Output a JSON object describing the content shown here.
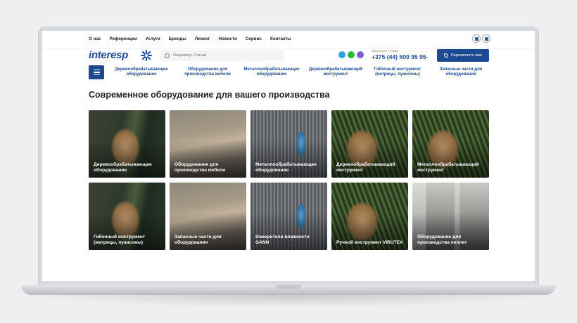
{
  "top_nav": [
    "О нас",
    "Референции",
    "Услуги",
    "Бренды",
    "Лизинг",
    "Новости",
    "Сервис",
    "Контакты"
  ],
  "logo": {
    "text": "interesp"
  },
  "search": {
    "placeholder": "Например: Станки"
  },
  "contact": {
    "caption": "Связаться с нами",
    "phone": "+375 (44) 500 95 95",
    "call_button": "Перезвоните мне"
  },
  "categories": [
    "Деревообрабатывающее оборудование",
    "Оборудование для производства мебели",
    "Металлообрабатывающее оборудование",
    "Деревообрабатывающий инструмент",
    "Гибочный инструмент (матрицы, пуансоны)",
    "Запасные части для оборудования"
  ],
  "page_title": "Современное оборудование для вашего производства",
  "cards": [
    "Деревообрабатывающее оборудование",
    "Оборудование для производства мебели",
    "Металлообрабатывающее оборудование",
    "Деревообрабатывающий инструмент",
    "Металлообрабатывающий инструмент",
    "Гибочный инструмент (матрицы, пуансоны)",
    "Запасные части для оборудования",
    "Измерители влажности GANN",
    "Ручной инструмент VIRUTEX",
    "Оборудование для производства пеллет"
  ],
  "colors": {
    "brand": "#1d4a8e",
    "telegram": "#2aa3df",
    "whatsapp": "#2bb741",
    "viber": "#7b5cd6"
  }
}
